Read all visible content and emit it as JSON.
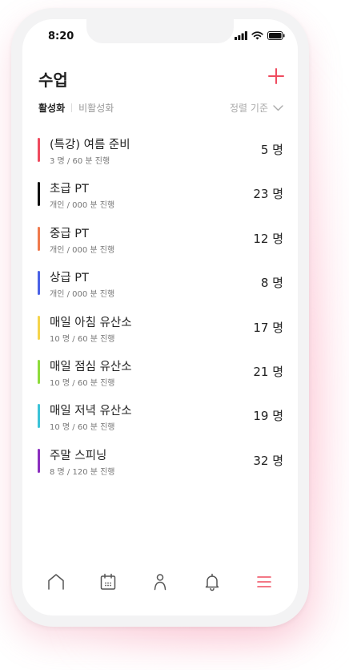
{
  "status": {
    "time": "8:20"
  },
  "header": {
    "title": "수업"
  },
  "tabs": {
    "active": "활성화",
    "inactive": "비활성화"
  },
  "sort": {
    "label": "정렬 기준"
  },
  "classes": [
    {
      "name": "(특강) 여름 준비",
      "detail": "3 명 / 60 분 진행",
      "count": "5 명",
      "color": "#ef4b5f"
    },
    {
      "name": "초급 PT",
      "detail": "개인 / 000 분 진행",
      "count": "23 명",
      "color": "#111111"
    },
    {
      "name": "중급 PT",
      "detail": "개인 / 000 분 진행",
      "count": "12 명",
      "color": "#f07a4e"
    },
    {
      "name": "상급 PT",
      "detail": "개인 / 000 분 진행",
      "count": "8 명",
      "color": "#4b63e6"
    },
    {
      "name": "매일 아침 유산소",
      "detail": "10 명 / 60 분 진행",
      "count": "17 명",
      "color": "#f5d44c"
    },
    {
      "name": "매일 점심 유산소",
      "detail": "10 명 / 60 분 진행",
      "count": "21 명",
      "color": "#8edc3c"
    },
    {
      "name": "매일 저녁 유산소",
      "detail": "10 명 / 60 분 진행",
      "count": "19 명",
      "color": "#3cc3d8"
    },
    {
      "name": "주말 스피닝",
      "detail": "8 명 / 120 분 진행",
      "count": "32 명",
      "color": "#8b2fbf"
    }
  ],
  "nav": {
    "items": [
      "home-icon",
      "calendar-icon",
      "person-icon",
      "bell-icon",
      "menu-icon"
    ],
    "active": "menu-icon",
    "accent": "#ef4b5f"
  }
}
